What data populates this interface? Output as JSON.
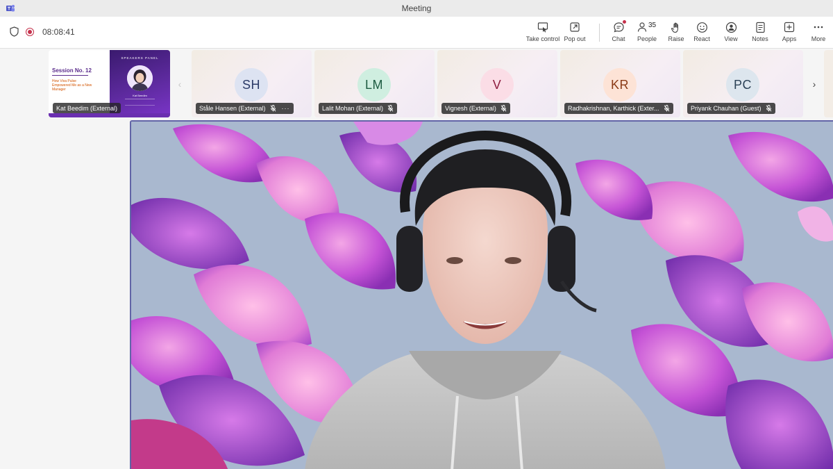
{
  "window": {
    "title": "Meeting"
  },
  "toolbar": {
    "timer": "08:08:41",
    "actions": [
      {
        "label": "Take control",
        "icon": "take-control-icon"
      },
      {
        "label": "Pop out",
        "icon": "pop-out-icon"
      },
      {
        "label": "Chat",
        "icon": "chat-icon"
      },
      {
        "label": "People",
        "icon": "people-icon",
        "count": "35"
      },
      {
        "label": "Raise",
        "icon": "raise-hand-icon"
      },
      {
        "label": "React",
        "icon": "react-icon"
      },
      {
        "label": "View",
        "icon": "view-icon"
      },
      {
        "label": "Notes",
        "icon": "notes-icon"
      },
      {
        "label": "Apps",
        "icon": "apps-icon"
      },
      {
        "label": "More",
        "icon": "more-icon"
      }
    ]
  },
  "shared_content": {
    "presenter": "Kat Beedim (External)",
    "slide": {
      "title": "Session No. 12",
      "subtitle": "How Viva Pulse Empowered Me as a New Manager",
      "panel_title": "SPEAKERS PANEL",
      "speaker": "Kat Beedim"
    }
  },
  "participants": [
    {
      "initials": "SH",
      "name": "Ståle Hansen (External)",
      "muted": true,
      "has_more": true,
      "avatar_bg": "#dde3f2",
      "avatar_fg": "#2b3a67"
    },
    {
      "initials": "LM",
      "name": "Lalit Mohan (External)",
      "muted": true,
      "has_more": false,
      "avatar_bg": "#cfeee0",
      "avatar_fg": "#1e5c42"
    },
    {
      "initials": "V",
      "name": "Vignesh (External)",
      "muted": true,
      "has_more": false,
      "avatar_bg": "#fbdde6",
      "avatar_fg": "#8e1d3f"
    },
    {
      "initials": "KR",
      "name": "Radhakrishnan, Karthick (Exter...",
      "muted": true,
      "has_more": false,
      "avatar_bg": "#fde3d6",
      "avatar_fg": "#8a3a16"
    },
    {
      "initials": "PC",
      "name": "Priyank Chauhan (Guest)",
      "muted": true,
      "has_more": false,
      "avatar_bg": "#dde6ee",
      "avatar_fg": "#2c4257"
    }
  ],
  "colors": {
    "accent": "#6264a7",
    "record": "#c4314b"
  }
}
